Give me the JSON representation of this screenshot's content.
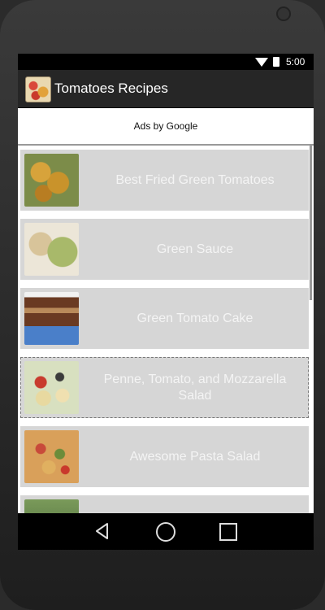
{
  "status_bar": {
    "time": "5:00"
  },
  "app_bar": {
    "title": "Tomatoes Recipes"
  },
  "ads": {
    "label": "Ads by Google"
  },
  "recipes": [
    {
      "title": "Best Fried Green Tomatoes",
      "thumbnail": "fried-green-tomatoes"
    },
    {
      "title": "Green Sauce",
      "thumbnail": "green-sauce"
    },
    {
      "title": "Green Tomato Cake",
      "thumbnail": "green-tomato-cake"
    },
    {
      "title": "Penne, Tomato, and Mozzarella Salad",
      "thumbnail": "penne-salad",
      "selected": true
    },
    {
      "title": "Awesome Pasta Salad",
      "thumbnail": "pasta-salad"
    },
    {
      "title": "",
      "thumbnail": "partial-item"
    }
  ],
  "nav_bar": {
    "buttons": [
      "back-icon",
      "home-icon",
      "recents-icon"
    ]
  }
}
